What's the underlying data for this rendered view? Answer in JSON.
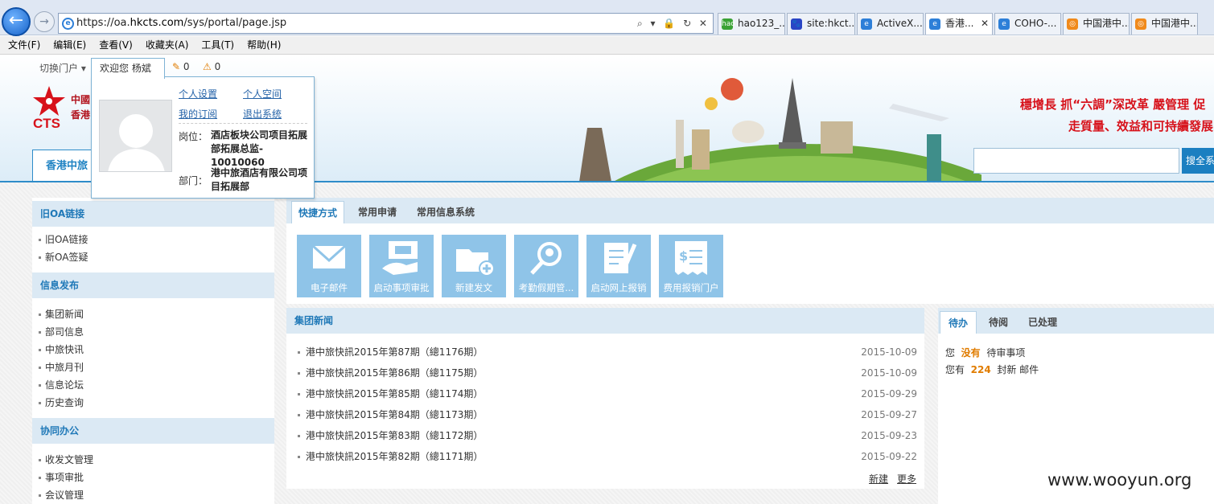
{
  "browser": {
    "url_prefix": "https://oa.",
    "url_host": "hkcts.com",
    "url_path": "/sys/portal/page.jsp",
    "address_tools": "⌕ ▾ 🔒 ↻ ✕",
    "tabs": [
      {
        "label": "hao123_...",
        "icon_color": "#3aa235",
        "icon_text": "hao"
      },
      {
        "label": "site:hkct...",
        "icon_color": "#2a45c5",
        "icon_text": "🐾"
      },
      {
        "label": "ActiveX...",
        "icon_color": "#2d7fd8",
        "icon_text": "e"
      },
      {
        "label": "香港...",
        "icon_color": "#2d7fd8",
        "icon_text": "e",
        "active": true,
        "close": "✕"
      },
      {
        "label": "COHO-...",
        "icon_color": "#2d7fd8",
        "icon_text": "e"
      },
      {
        "label": "中国港中...",
        "icon_color": "#f08a1c",
        "icon_text": "◎"
      },
      {
        "label": "中国港中...",
        "icon_color": "#f08a1c",
        "icon_text": "◎"
      }
    ]
  },
  "menubar": [
    "文件(F)",
    "编辑(E)",
    "查看(V)",
    "收藏夹(A)",
    "工具(T)",
    "帮助(H)"
  ],
  "header": {
    "switch_label": "切换门户 ▾",
    "welcome": "欢迎您 杨斌",
    "edit_count": "0",
    "warn_count": "0",
    "logo_cts": "CTS",
    "logo_line1": "中國",
    "logo_line2": "香港",
    "slogan1": "穩增長 抓“六調”深改革 嚴管理 促",
    "slogan2": "走質量、效益和可持續發展",
    "search_button": "搜全系",
    "portal_tab": "香港中旅"
  },
  "popup": {
    "links": [
      "个人设置",
      "个人空间",
      "我的订阅",
      "退出系统"
    ],
    "position_label": "岗位：",
    "position_value": [
      "酒店板块公司项目拓展",
      "部拓展总监-",
      "10010060"
    ],
    "dept_label": "部门：",
    "dept_value": [
      "港中旅酒店有限公司项",
      "目拓展部"
    ]
  },
  "sidebar": {
    "sections": [
      {
        "title": "旧OA链接",
        "items": [
          "旧OA链接",
          "新OA签疑"
        ]
      },
      {
        "title": "信息发布",
        "items": [
          "集团新闻",
          "部司信息",
          "中旅快讯",
          "中旅月刊",
          "信息论坛",
          "历史查询"
        ]
      },
      {
        "title": "协同办公",
        "items": [
          "收发文管理",
          "事项审批",
          "会议管理"
        ]
      }
    ]
  },
  "quick": {
    "tabs": [
      "快捷方式",
      "常用申请",
      "常用信息系统"
    ],
    "icons": [
      {
        "label": "电子邮件",
        "icon": "envelope-icon"
      },
      {
        "label": "启动事项审批",
        "icon": "approval-icon"
      },
      {
        "label": "新建发文",
        "icon": "new-folder-icon"
      },
      {
        "label": "考勤假期管...",
        "icon": "attendance-icon"
      },
      {
        "label": "启动网上报销",
        "icon": "reimburse-icon"
      },
      {
        "label": "费用报销门户",
        "icon": "expense-icon"
      }
    ]
  },
  "news": {
    "title": "集团新闻",
    "rows": [
      {
        "title": "港中旅快訊2015年第87期（總1176期）",
        "date": "2015-10-09"
      },
      {
        "title": "港中旅快訊2015年第86期（總1175期）",
        "date": "2015-10-09"
      },
      {
        "title": "港中旅快訊2015年第85期（總1174期）",
        "date": "2015-09-29"
      },
      {
        "title": "港中旅快訊2015年第84期（總1173期）",
        "date": "2015-09-27"
      },
      {
        "title": "港中旅快訊2015年第83期（總1172期）",
        "date": "2015-09-23"
      },
      {
        "title": "港中旅快訊2015年第82期（總1171期）",
        "date": "2015-09-22"
      }
    ],
    "new_link": "新建",
    "more_link": "更多"
  },
  "todo": {
    "tabs": [
      "待办",
      "待阅",
      "已处理"
    ],
    "line1_a": "您",
    "line1_hl": "没有",
    "line1_b": "待审事项",
    "line2_a": "您有",
    "line2_hl": "224",
    "line2_b": "封新 邮件"
  },
  "watermark": "www.wooyun.org"
}
